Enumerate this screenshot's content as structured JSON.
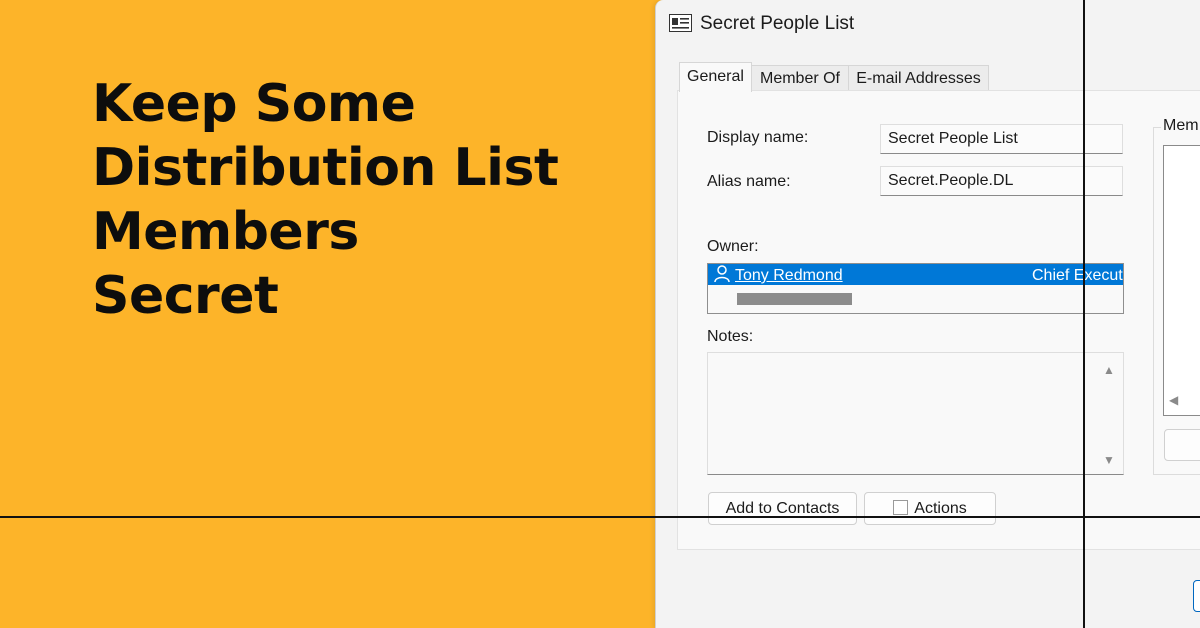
{
  "banner": {
    "headline_lines": [
      "Keep Some",
      "Distribution List",
      "Members",
      "Secret"
    ]
  },
  "dialog": {
    "title": "Secret People List",
    "tabs": [
      {
        "label": "General",
        "active": true
      },
      {
        "label": "Member Of",
        "active": false
      },
      {
        "label": "E-mail Addresses",
        "active": false
      }
    ],
    "fields": {
      "display_name_label": "Display name:",
      "display_name_value": "Secret People List",
      "alias_name_label": "Alias name:",
      "alias_name_value": "Secret.People.DL",
      "owner_label": "Owner:",
      "owner_name": "Tony Redmond",
      "owner_title": "Chief Execut",
      "notes_label": "Notes:",
      "notes_value": ""
    },
    "members_label": "Mem",
    "buttons": {
      "add_to_contacts": "Add to Contacts",
      "actions": "Actions"
    },
    "icons": {
      "app": "contact-card-icon",
      "owner": "person-icon",
      "actions": "checkbox-icon"
    },
    "colors": {
      "selection": "#0078d7",
      "background": "#FDB429"
    }
  }
}
